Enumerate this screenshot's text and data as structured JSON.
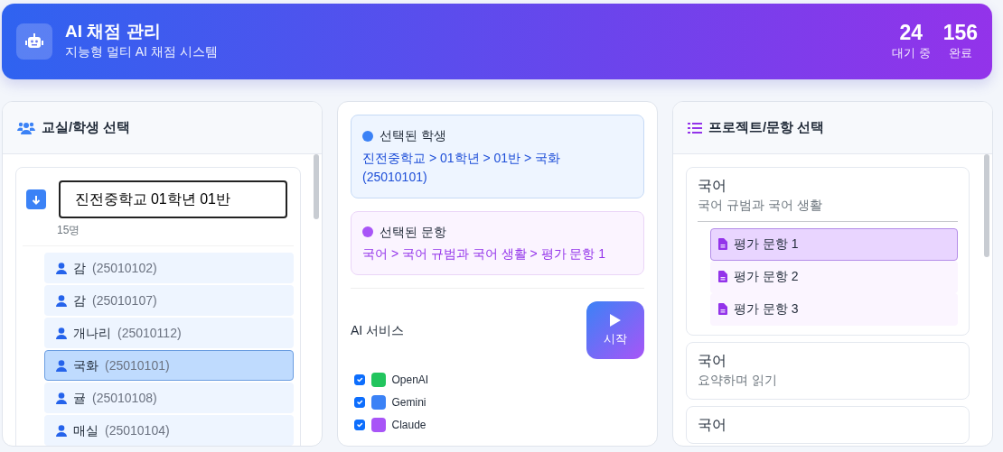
{
  "header": {
    "title": "AI 채점 관리",
    "subtitle": "지능형 멀티 AI 채점 시스템",
    "stats": [
      {
        "value": "24",
        "label": "대기 중"
      },
      {
        "value": "156",
        "label": "완료"
      }
    ]
  },
  "classroom_panel": {
    "title": "교실/학생 선택",
    "class_name": "진전중학교 01학년 01반",
    "count": "15명",
    "students": [
      {
        "name": "감",
        "id": "(25010102)",
        "selected": false
      },
      {
        "name": "감",
        "id": "(25010107)",
        "selected": false
      },
      {
        "name": "개나리",
        "id": "(25010112)",
        "selected": false
      },
      {
        "name": "국화",
        "id": "(25010101)",
        "selected": true
      },
      {
        "name": "귤",
        "id": "(25010108)",
        "selected": false
      },
      {
        "name": "매실",
        "id": "(25010104)",
        "selected": false
      }
    ]
  },
  "summary_panel": {
    "selected_student": {
      "label": "선택된 학생",
      "path": "진전중학교 > 01학년 > 01반 > 국화 (25010101)"
    },
    "selected_item": {
      "label": "선택된 문항",
      "path": "국어 > 국어 규범과 국어 생활 > 평가 문항 1"
    },
    "services_label": "AI 서비스",
    "start_button": "시작",
    "services": [
      {
        "name": "OpenAI",
        "checked": true,
        "color": "#22c55e"
      },
      {
        "name": "Gemini",
        "checked": true,
        "color": "#3b82f6"
      },
      {
        "name": "Claude",
        "checked": true,
        "color": "#a855f7"
      }
    ]
  },
  "project_panel": {
    "title": "프로젝트/문항 선택",
    "projects": [
      {
        "subject": "국어",
        "unit": "국어 규범과 국어 생활",
        "items": [
          {
            "label": "평가 문항 1",
            "selected": true
          },
          {
            "label": "평가 문항 2",
            "selected": false
          },
          {
            "label": "평가 문항 3",
            "selected": false
          }
        ]
      },
      {
        "subject": "국어",
        "unit": "요약하며 읽기"
      },
      {
        "subject": "국어"
      }
    ]
  }
}
